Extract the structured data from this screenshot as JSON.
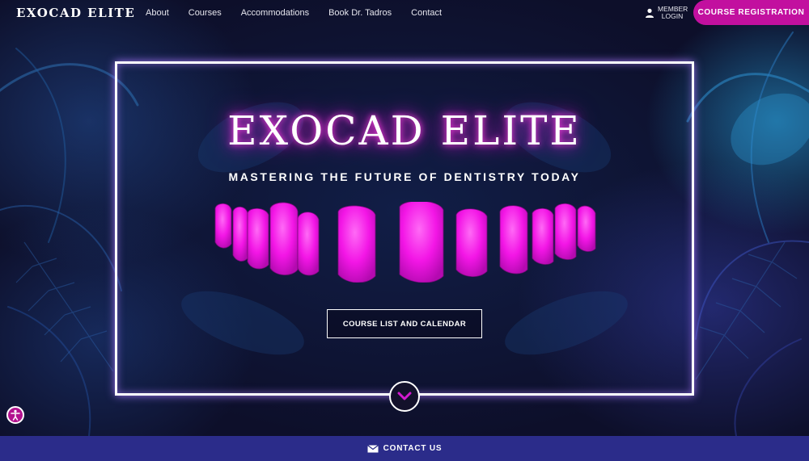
{
  "header": {
    "logo": "EXOCAD ELITE",
    "nav": [
      "About",
      "Courses",
      "Accommodations",
      "Book Dr. Tadros",
      "Contact"
    ],
    "member_login": "MEMBER LOGIN",
    "registration_button": "COURSE REGISTRATION"
  },
  "hero": {
    "title": "EXOCAD ELITE",
    "subtitle": "MASTERING THE FUTURE OF DENTISTRY TODAY",
    "cta_button": "COURSE LIST AND CALENDAR",
    "scroll_icon": "chevron-down-icon"
  },
  "footer": {
    "contact_label": "CONTACT US",
    "contact_icon": "envelope-icon"
  },
  "accessibility_icon": "accessibility-icon",
  "colors": {
    "accent": "#c2109f",
    "teeth": "#ff1ff0",
    "contact_bar": "#2b2c8a",
    "background": "#0d0f2a"
  }
}
